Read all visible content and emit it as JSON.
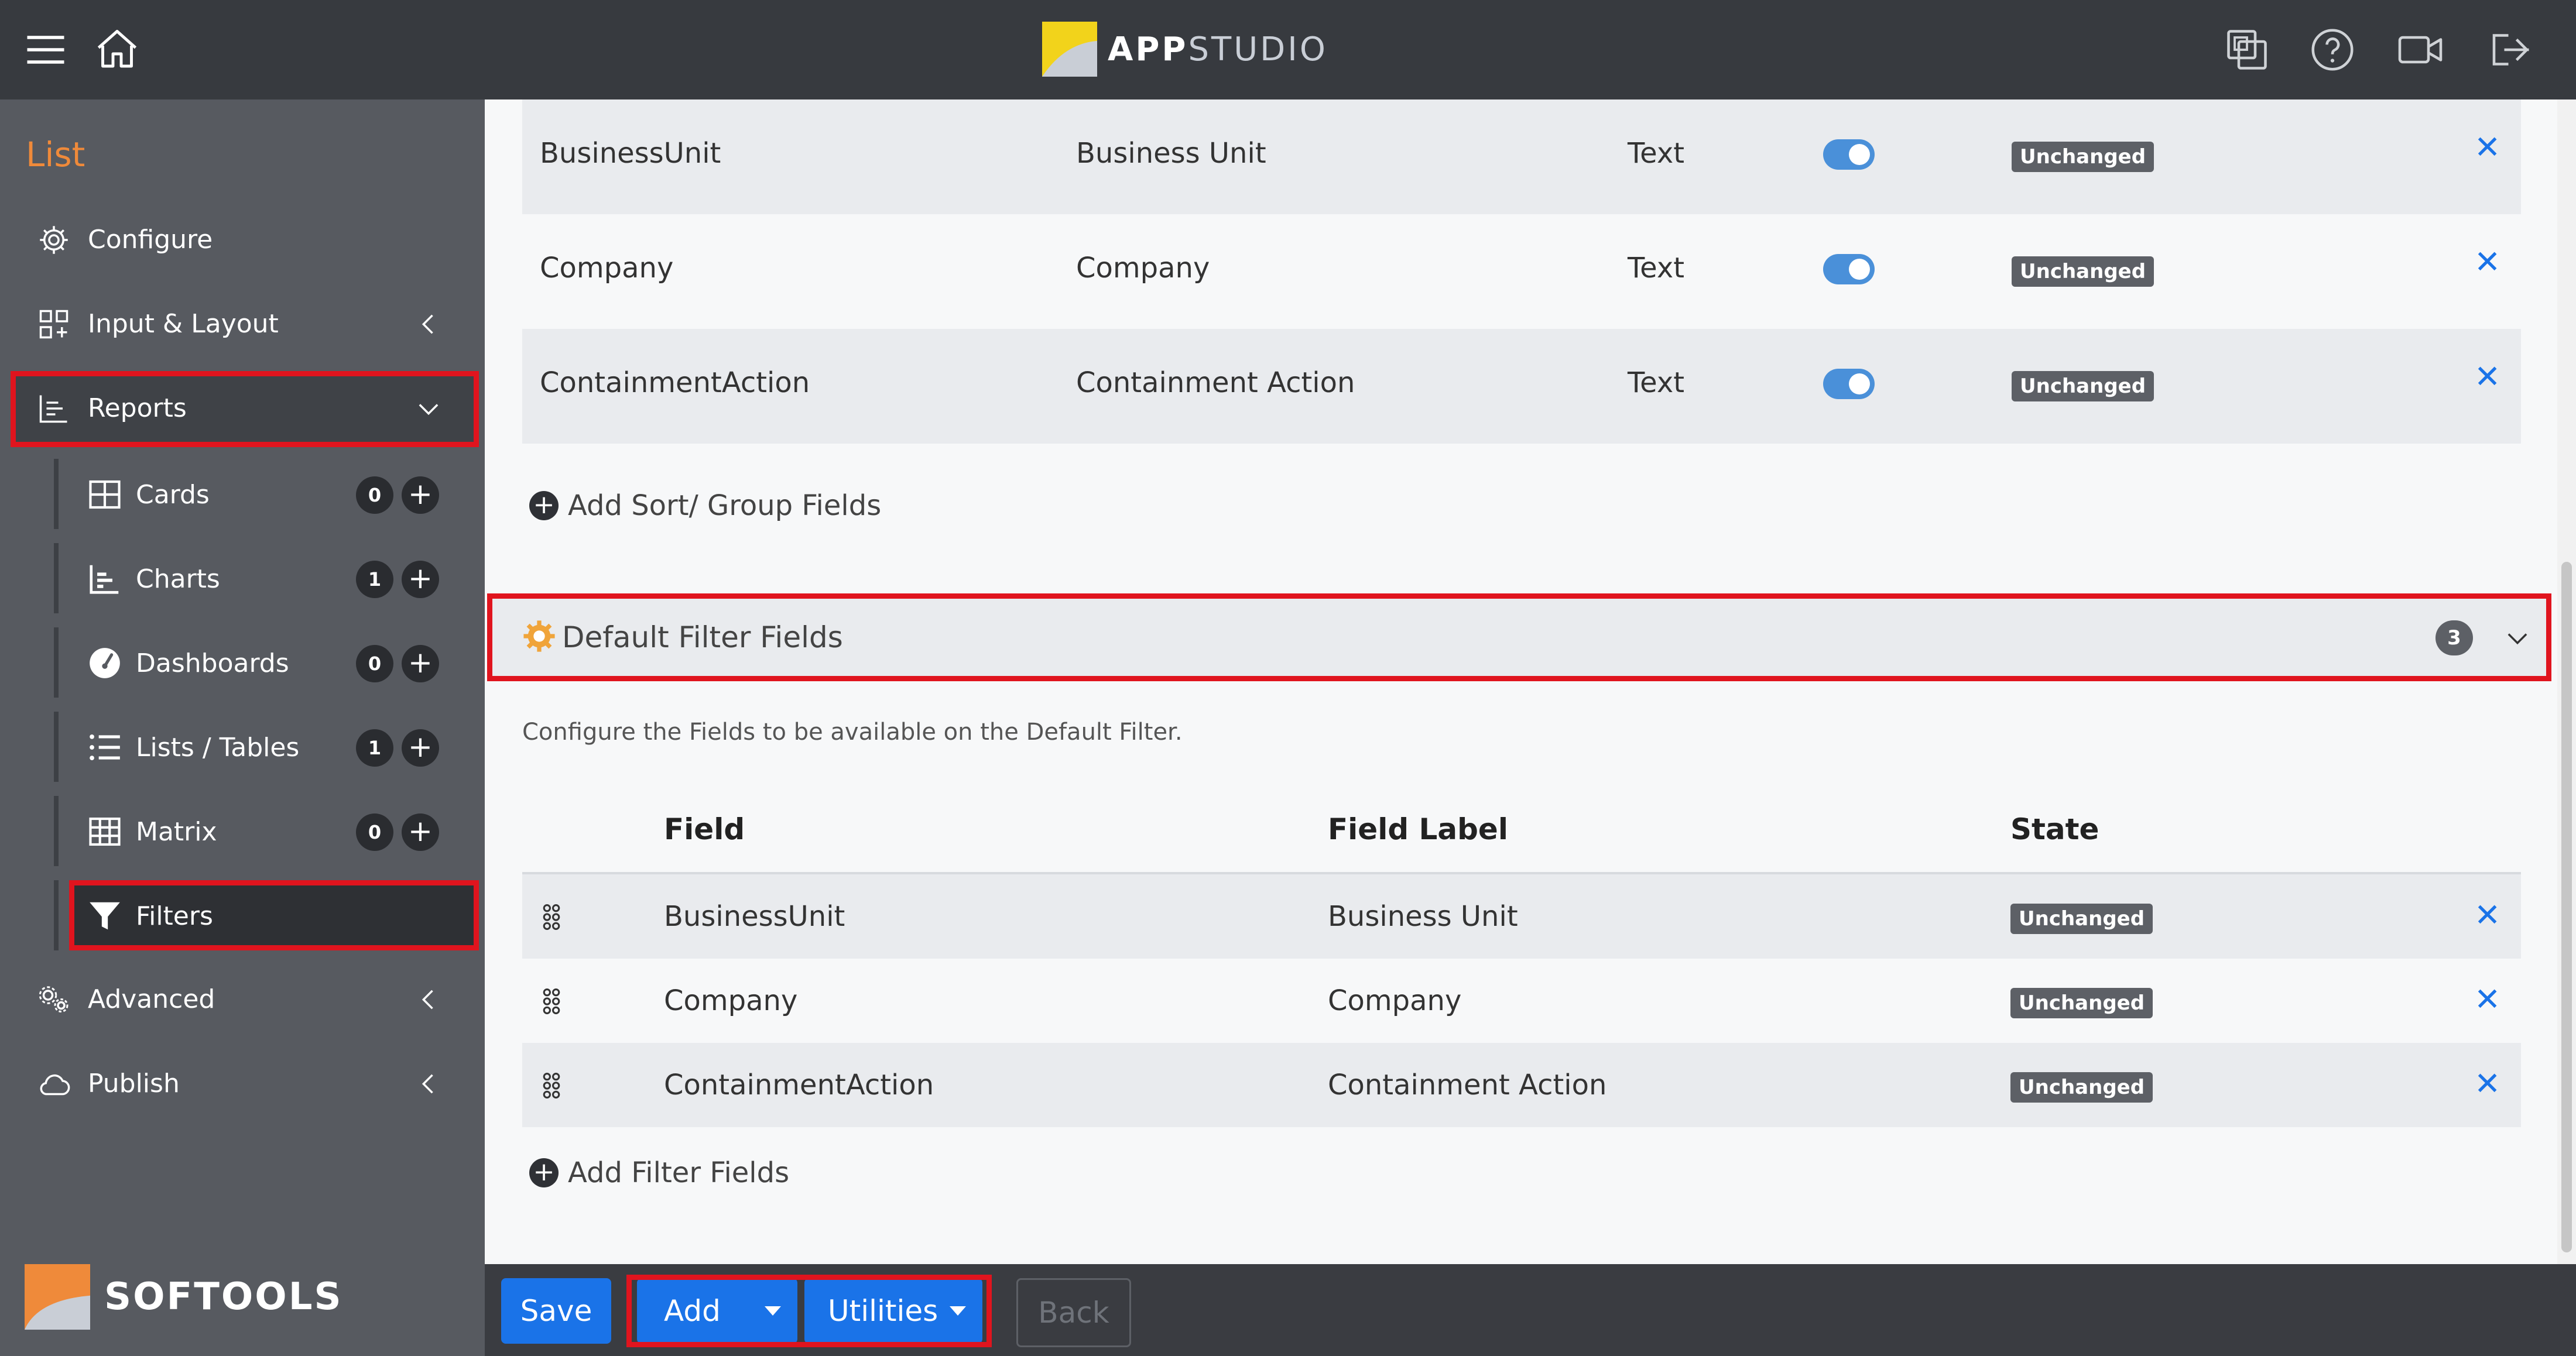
{
  "brand": {
    "app_logo_part1": "APP",
    "app_logo_part2": "STUDIO",
    "company": "SOFTOOLS",
    "accent": "#ef8a3a",
    "primary": "#1a73e8",
    "highlight": "#e0141e"
  },
  "topbar": {
    "icons": [
      "menu-icon",
      "home-icon",
      "copy-icon",
      "help-icon",
      "video-icon",
      "logout-icon"
    ]
  },
  "sidebar": {
    "title": "List",
    "items": [
      {
        "label": "Configure",
        "icon": "gear-icon"
      },
      {
        "label": "Input & Layout",
        "icon": "layout-icon"
      },
      {
        "label": "Reports",
        "icon": "reports-icon"
      },
      {
        "label": "Advanced",
        "icon": "gears-icon"
      },
      {
        "label": "Publish",
        "icon": "cloud-icon"
      }
    ],
    "report_items": [
      {
        "label": "Cards",
        "count": "0",
        "icon": "cards-icon"
      },
      {
        "label": "Charts",
        "count": "1",
        "icon": "chart-icon"
      },
      {
        "label": "Dashboards",
        "count": "0",
        "icon": "gauge-icon"
      },
      {
        "label": "Lists / Tables",
        "count": "1",
        "icon": "list-icon"
      },
      {
        "label": "Matrix",
        "count": "0",
        "icon": "grid-icon"
      },
      {
        "label": "Filters",
        "icon": "filter-icon"
      }
    ]
  },
  "sort_fields": {
    "rows": [
      {
        "field": "BusinessUnit",
        "label": "Business Unit",
        "type": "Text",
        "state": "Unchanged"
      },
      {
        "field": "Company",
        "label": "Company",
        "type": "Text",
        "state": "Unchanged"
      },
      {
        "field": "ContainmentAction",
        "label": "Containment Action",
        "type": "Text",
        "state": "Unchanged"
      }
    ],
    "add_label": "Add Sort/ Group Fields"
  },
  "filter_section": {
    "title": "Default Filter Fields",
    "count": "3",
    "description": "Configure the Fields to be available on the Default Filter.",
    "headers": {
      "field": "Field",
      "label": "Field Label",
      "state": "State"
    },
    "rows": [
      {
        "field": "BusinessUnit",
        "label": "Business Unit",
        "state": "Unchanged"
      },
      {
        "field": "Company",
        "label": "Company",
        "state": "Unchanged"
      },
      {
        "field": "ContainmentAction",
        "label": "Containment Action",
        "state": "Unchanged"
      }
    ],
    "add_label": "Add Filter Fields"
  },
  "footer": {
    "save": "Save",
    "add": "Add",
    "utilities": "Utilities",
    "back": "Back"
  }
}
